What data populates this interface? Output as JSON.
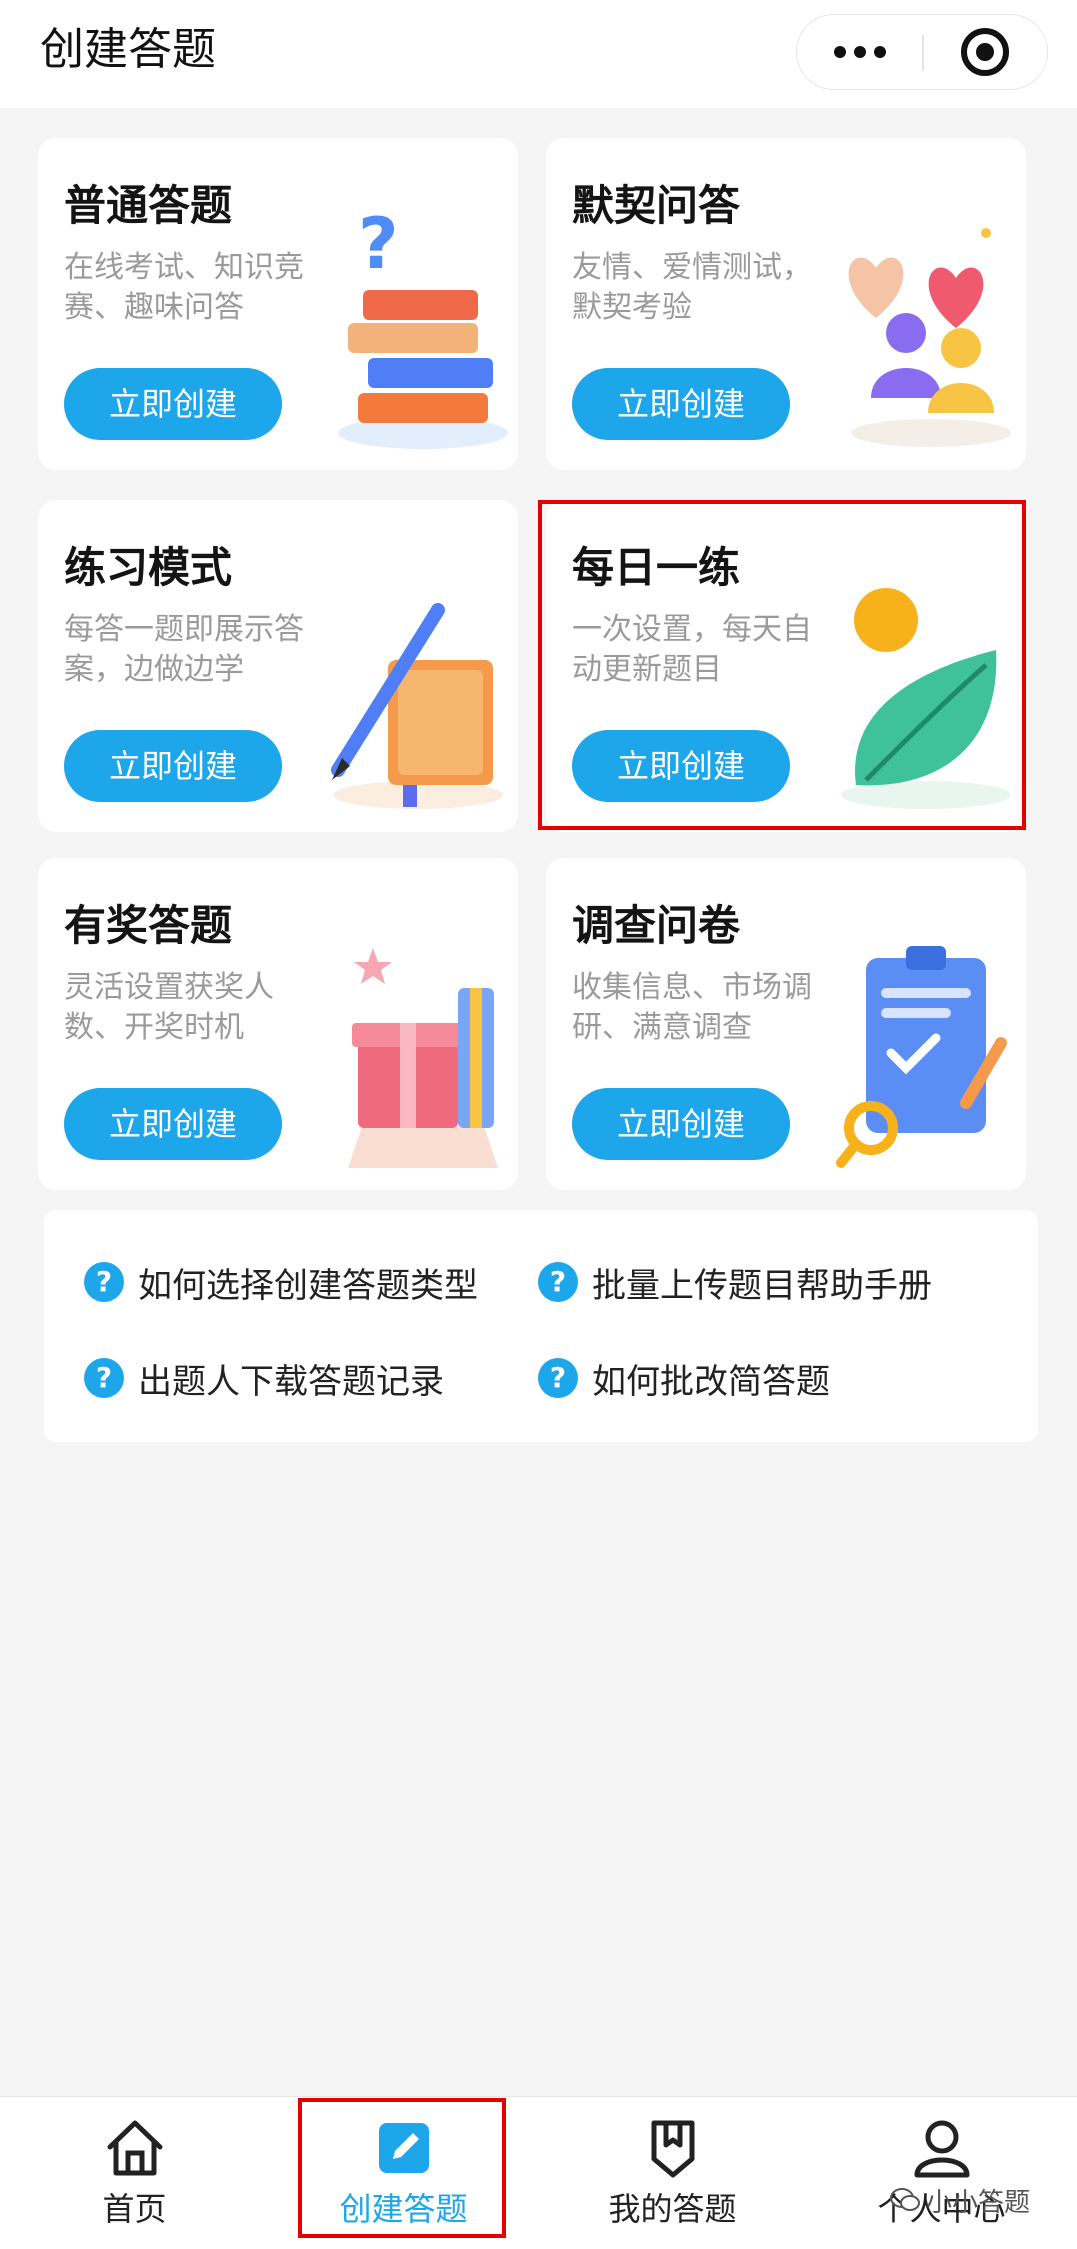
{
  "header": {
    "title": "创建答题"
  },
  "capsule": {
    "more_icon": "more-dots-icon",
    "close_icon": "target-circle-icon"
  },
  "cards": [
    {
      "title": "普通答题",
      "desc": "在线考试、知识竞赛、趣味问答",
      "button": "立即创建",
      "art": "books-question-icon"
    },
    {
      "title": "默契问答",
      "desc": "友情、爱情测试，默契考验",
      "button": "立即创建",
      "art": "hearts-people-icon"
    },
    {
      "title": "练习模式",
      "desc": "每答一题即展示答案，边做边学",
      "button": "立即创建",
      "art": "pencil-book-icon"
    },
    {
      "title": "每日一练",
      "desc": "一次设置，每天自动更新题目",
      "button": "立即创建",
      "art": "sun-leaf-icon"
    },
    {
      "title": "有奖答题",
      "desc": "灵活设置获奖人数、开奖时机",
      "button": "立即创建",
      "art": "gift-box-icon"
    },
    {
      "title": "调查问卷",
      "desc": "收集信息、市场调研、满意调查",
      "button": "立即创建",
      "art": "clipboard-search-icon"
    }
  ],
  "help": [
    {
      "label": "如何选择创建答题类型"
    },
    {
      "label": "批量上传题目帮助手册"
    },
    {
      "label": "出题人下载答题记录"
    },
    {
      "label": "如何批改简答题"
    }
  ],
  "help_icon_glyph": "?",
  "tabs": [
    {
      "label": "首页",
      "icon": "home-icon"
    },
    {
      "label": "创建答题",
      "icon": "edit-icon"
    },
    {
      "label": "我的答题",
      "icon": "badge-icon"
    },
    {
      "label": "个人中心",
      "icon": "user-icon"
    }
  ],
  "watermark": "小小答题",
  "colors": {
    "accent": "#1ea6ea",
    "highlight": "#e60000",
    "text": "#222222",
    "muted": "#9a9a9a"
  }
}
